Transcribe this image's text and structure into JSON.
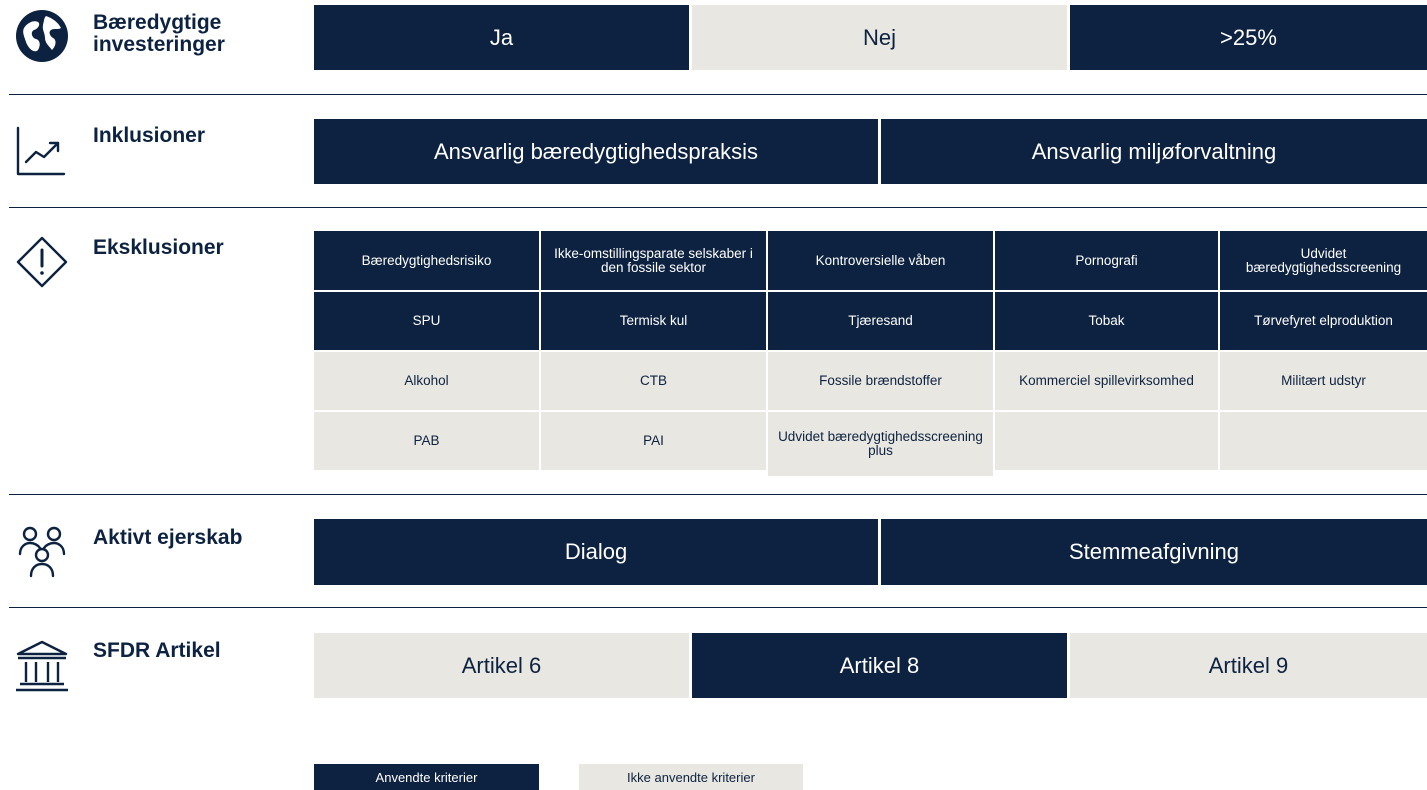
{
  "colors": {
    "applied": "#0d2240",
    "not_applied": "#e8e7e1",
    "divider": "#0d2240"
  },
  "sections": {
    "sustainable": {
      "icon": "globe-icon",
      "label": "Bæredygtige investeringer",
      "options": [
        {
          "label": "Ja",
          "applied": true
        },
        {
          "label": "Nej",
          "applied": false
        },
        {
          "label": ">25%",
          "applied": true
        }
      ]
    },
    "inclusions": {
      "icon": "trend-chart-icon",
      "label": "Inklusioner",
      "options": [
        {
          "label": "Ansvarlig bæredygtighedspraksis",
          "applied": true
        },
        {
          "label": "Ansvarlig miljøforvaltning",
          "applied": true
        }
      ]
    },
    "exclusions": {
      "icon": "warning-diamond-icon",
      "label": "Eksklusioner",
      "options": [
        {
          "label": "Bæredygtighedsrisiko",
          "applied": true
        },
        {
          "label": "Ikke-omstillingsparate selskaber i den fossile sektor",
          "applied": true
        },
        {
          "label": "Kontroversielle våben",
          "applied": true
        },
        {
          "label": "Pornografi",
          "applied": true
        },
        {
          "label": "Udvidet bæredygtighedsscreening",
          "applied": true
        },
        {
          "label": "SPU",
          "applied": true
        },
        {
          "label": "Termisk kul",
          "applied": true
        },
        {
          "label": "Tjæresand",
          "applied": true
        },
        {
          "label": "Tobak",
          "applied": true
        },
        {
          "label": "Tørvefyret elproduktion",
          "applied": true
        },
        {
          "label": "Alkohol",
          "applied": false
        },
        {
          "label": "CTB",
          "applied": false
        },
        {
          "label": "Fossile brændstoffer",
          "applied": false
        },
        {
          "label": "Kommerciel spillevirksomhed",
          "applied": false
        },
        {
          "label": "Militært udstyr",
          "applied": false
        },
        {
          "label": "PAB",
          "applied": false
        },
        {
          "label": "PAI",
          "applied": false
        },
        {
          "label": "Udvidet bæredygtighedsscreening plus",
          "applied": false
        },
        {
          "label": "",
          "applied": false
        },
        {
          "label": "",
          "applied": false
        }
      ]
    },
    "ownership": {
      "icon": "people-group-icon",
      "label": "Aktivt ejerskab",
      "options": [
        {
          "label": "Dialog",
          "applied": true
        },
        {
          "label": "Stemmeafgivning",
          "applied": true
        }
      ]
    },
    "sfdr": {
      "icon": "bank-building-icon",
      "label": "SFDR Artikel",
      "options": [
        {
          "label": "Artikel 6",
          "applied": false
        },
        {
          "label": "Artikel 8",
          "applied": true
        },
        {
          "label": "Artikel 9",
          "applied": false
        }
      ]
    }
  },
  "legend": {
    "applied_label": "Anvendte kriterier",
    "not_applied_label": "Ikke anvendte kriterier"
  }
}
